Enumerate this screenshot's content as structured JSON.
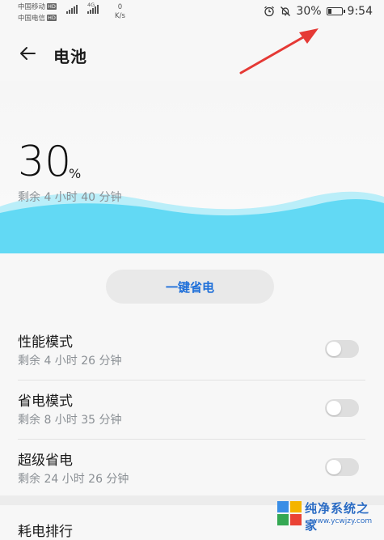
{
  "status_bar": {
    "carrier1": "中国移动",
    "carrier2": "中国电信",
    "hd_badge": "HD",
    "net_tag": "4G",
    "net_speed_value": "0",
    "net_speed_unit": "K/s",
    "battery_percent_text": "30%",
    "battery_level": 0.3,
    "time": "9:54",
    "icons": [
      "alarm-icon",
      "mute-bell-icon",
      "battery-icon",
      "signal-icon",
      "wifi-icon"
    ]
  },
  "header": {
    "back_icon": "arrow-left-icon",
    "title": "电池"
  },
  "battery": {
    "percent": "30",
    "unit": "%",
    "remaining": "剩余 4 小时 40 分钟",
    "wave_color": "#62d9f4"
  },
  "power_save_button": "一键省电",
  "modes": [
    {
      "label": "性能模式",
      "sub": "剩余 4 小时 26 分钟",
      "enabled": false
    },
    {
      "label": "省电模式",
      "sub": "剩余 8 小时 35 分钟",
      "enabled": false
    },
    {
      "label": "超级省电",
      "sub": "剩余 24 小时 26 分钟",
      "enabled": false
    }
  ],
  "consumption_rank": "耗电排行",
  "watermark": {
    "name": "纯净系统之家",
    "url": "www.ycwjzy.com"
  },
  "colors": {
    "accent": "#1e6fd9",
    "wave": "#62d9f4",
    "annotation_arrow": "#e53935"
  }
}
